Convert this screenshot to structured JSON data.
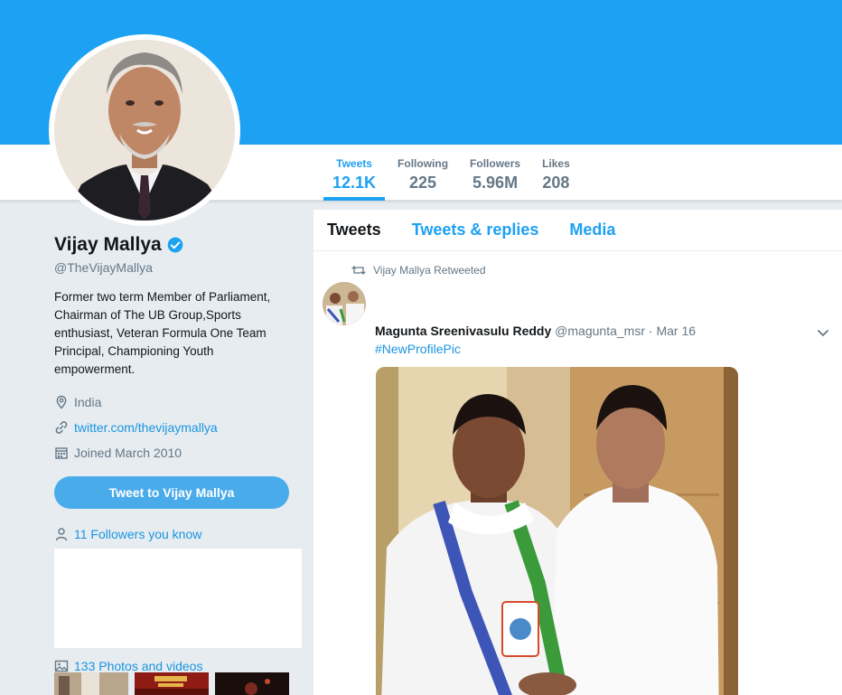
{
  "profile": {
    "name": "Vijay Mallya",
    "handle": "@TheVijayMallya",
    "bio": "Former two term Member of Parliament, Chairman of The UB Group,Sports enthusiast, Veteran Formula One Team Principal, Championing Youth empowerment.",
    "location": "India",
    "website": "twitter.com/thevijaymallya",
    "joined": "Joined March 2010",
    "tweet_to_label": "Tweet to Vijay Mallya",
    "followers_you_know": "11 Followers you know",
    "photos_videos": "133 Photos and videos",
    "verified_icon": "verified-badge-icon"
  },
  "stats": [
    {
      "label": "Tweets",
      "value": "12.1K"
    },
    {
      "label": "Following",
      "value": "225"
    },
    {
      "label": "Followers",
      "value": "5.96M"
    },
    {
      "label": "Likes",
      "value": "208"
    }
  ],
  "timeline": {
    "tabs": [
      "Tweets",
      "Tweets & replies",
      "Media"
    ],
    "tweet": {
      "retweet_note": "Vijay Mallya Retweeted",
      "author_name": "Magunta Sreenivasulu Reddy",
      "author_handle": "@magunta_msr",
      "separator": "·",
      "date": "Mar 16",
      "text": "#NewProfilePic"
    }
  },
  "colors": {
    "brand": "#1da1f2",
    "link": "#1b95e0",
    "muted": "#657786",
    "button": "#4aabeb",
    "page_bg": "#e6ecf0"
  }
}
